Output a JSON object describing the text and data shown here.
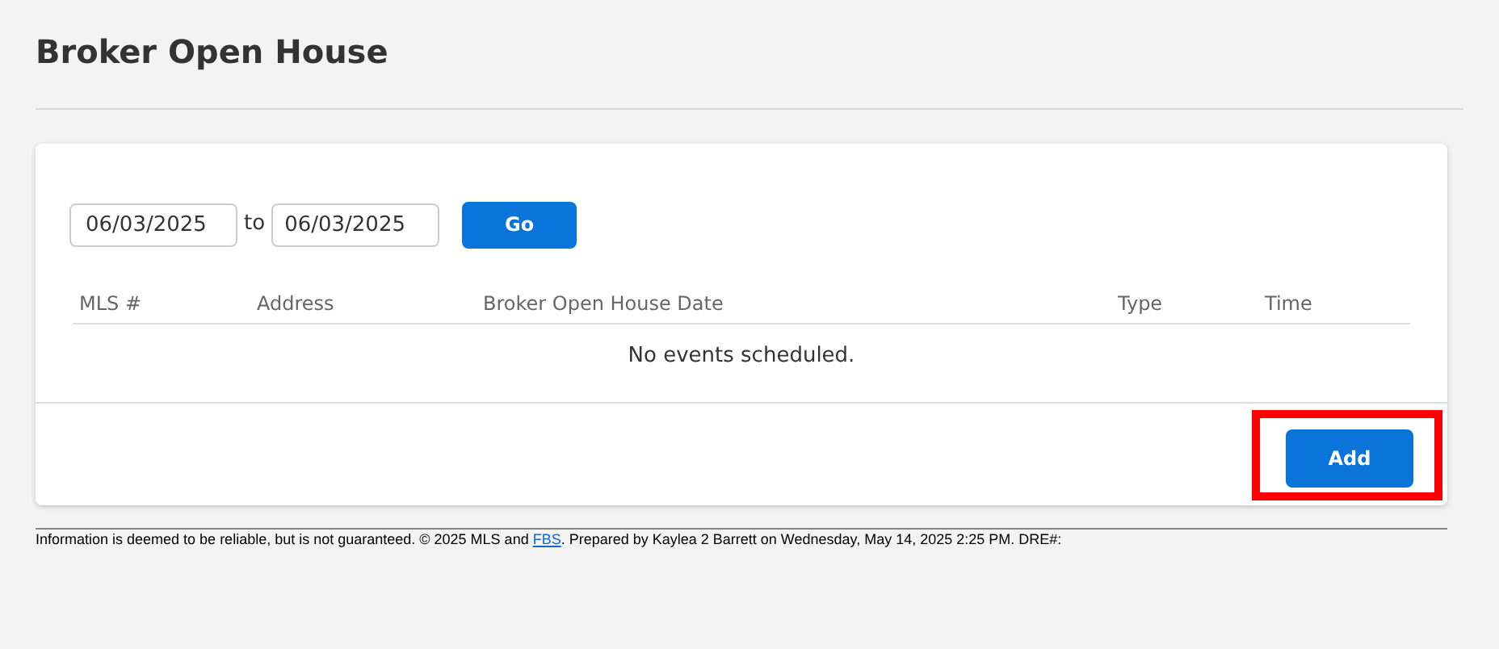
{
  "page": {
    "title": "Broker Open House"
  },
  "filter": {
    "from_date": "06/03/2025",
    "separator": "to",
    "to_date": "06/03/2025",
    "go_button": "Go"
  },
  "table": {
    "columns": [
      "MLS #",
      "Address",
      "Broker Open House Date",
      "Type",
      "Time"
    ],
    "empty_message": "No events scheduled."
  },
  "add_button": {
    "label": "Add",
    "highlighted": true
  },
  "footer": {
    "before_link": "Information is deemed to be reliable, but is not guaranteed. © 2025 MLS and",
    "link": "FBS",
    "after_link": ". Prepared by Kaylea 2 Barrett on Wednesday, May 14, 2025 2:25 PM. DRE#:"
  }
}
